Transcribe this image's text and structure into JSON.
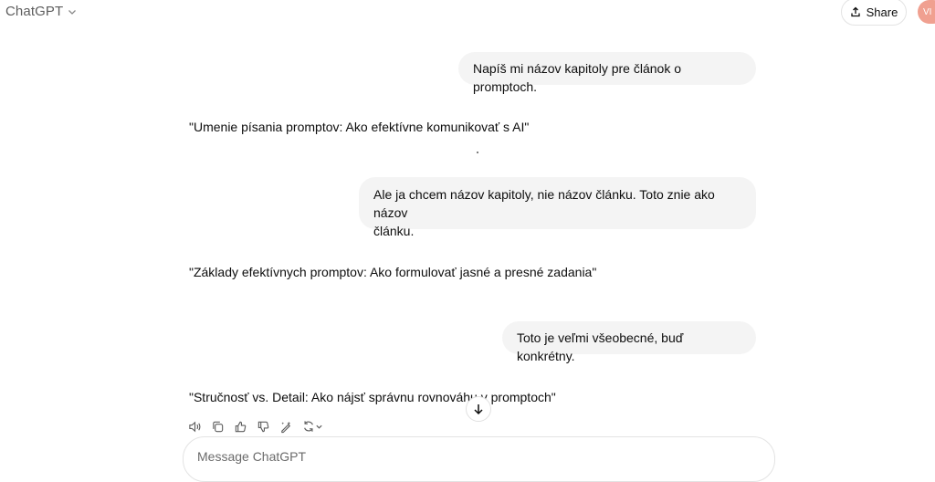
{
  "header": {
    "model_name": "ChatGPT",
    "share_label": "Share",
    "avatar_initials": "VI"
  },
  "messages": [
    {
      "role": "user",
      "text": "Napíš mi názov kapitoly pre článok o promptoch."
    },
    {
      "role": "assistant",
      "text": "\"Umenie písania promptov: Ako efektívne komunikovať s AI\""
    },
    {
      "role": "user",
      "lines": [
        "Ale ja chcem názov kapitoly, nie názov článku. Toto znie ako názov",
        "článku."
      ]
    },
    {
      "role": "assistant",
      "text": "\"Základy efektívnych promptov: Ako formulovať jasné a presné zadania\""
    },
    {
      "role": "user",
      "text": "Toto je veľmi všeobecné, buď konkrétny."
    },
    {
      "role": "assistant",
      "text": "\"Stručnosť vs. Detail: Ako nájsť správnu rovnováhu v promptoch\""
    }
  ],
  "composer": {
    "placeholder": "Message ChatGPT"
  },
  "icons": {
    "actions": [
      "speaker-icon",
      "copy-icon",
      "thumbs-up-icon",
      "thumbs-down-icon",
      "edit-model-icon",
      "regenerate-icon"
    ],
    "scroll": "arrow-down-icon"
  },
  "colors": {
    "bubble_bg": "#f4f4f4",
    "avatar_bg": "#f0a090"
  }
}
